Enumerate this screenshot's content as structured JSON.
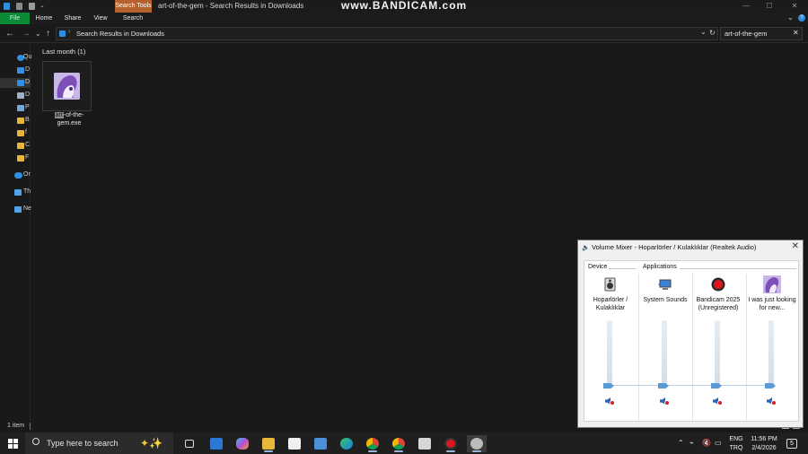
{
  "window": {
    "search_tools_tab": "Search Tools",
    "title": "art-of-the-gem - Search Results in Downloads",
    "watermark": "www.BANDICAM.com"
  },
  "ribbon": {
    "tabs": [
      "File",
      "Home",
      "Share",
      "View",
      "Search"
    ]
  },
  "address": {
    "path": "Search Results in Downloads",
    "search_value": "art-of-the-gem"
  },
  "navpane": {
    "items": [
      {
        "label": "Qu",
        "icon": "star-icon",
        "color": "#2f8fe0"
      },
      {
        "label": "D",
        "icon": "desktop-folder-icon",
        "color": "#3a8ee6"
      },
      {
        "label": "D",
        "icon": "downloads-folder-icon",
        "color": "#2f8fe0"
      },
      {
        "label": "D",
        "icon": "documents-folder-icon",
        "color": "#9fb3c8"
      },
      {
        "label": "P",
        "icon": "pictures-folder-icon",
        "color": "#78a9d6"
      },
      {
        "label": "B",
        "icon": "folder-icon",
        "color": "#e8b73a"
      },
      {
        "label": "f",
        "icon": "folder-icon",
        "color": "#e8b73a"
      },
      {
        "label": "C",
        "icon": "folder-icon",
        "color": "#e8b73a"
      },
      {
        "label": "F",
        "icon": "folder-icon",
        "color": "#e8b73a"
      },
      {
        "label": "Or",
        "icon": "onedrive-icon",
        "color": "#2f8fe0"
      },
      {
        "label": "Th",
        "icon": "this-pc-icon",
        "color": "#4ea3e8"
      },
      {
        "label": "Ne",
        "icon": "network-icon",
        "color": "#4ea3e8"
      }
    ]
  },
  "content": {
    "group_header": "Last month (1)",
    "file": {
      "name_highlight": "art",
      "name_rest_line1": "-of-the-",
      "name_line2": "gem.exe"
    }
  },
  "status": {
    "item_count": "1 item"
  },
  "mixer": {
    "title": "Volume Mixer - Hoparlörler / Kulaklıklar (Realtek Audio)",
    "device_label": "Device",
    "applications_label": "Applications",
    "channels": [
      {
        "name": "Hoparlörler / Kulaklıklar",
        "icon": "speaker-device-icon",
        "volume": 0
      },
      {
        "name": "System Sounds",
        "icon": "system-sounds-icon",
        "volume": 0
      },
      {
        "name": "Bandicam 2025 (Unregistered)",
        "icon": "bandicam-record-icon",
        "volume": 0
      },
      {
        "name": "I was just looking for new...",
        "icon": "app-thumbnail-icon",
        "volume": 0
      }
    ]
  },
  "taskbar": {
    "search_placeholder": "Type here to search",
    "language_line1": "ENG",
    "language_line2": "TRQ",
    "time": "11:56 PM",
    "date": "2/4/2026",
    "notification_count": "5"
  },
  "colors": {
    "accent_green": "#0b8a36",
    "search_tools_orange": "#b5622f",
    "slider_blue": "#5b9bd5"
  }
}
